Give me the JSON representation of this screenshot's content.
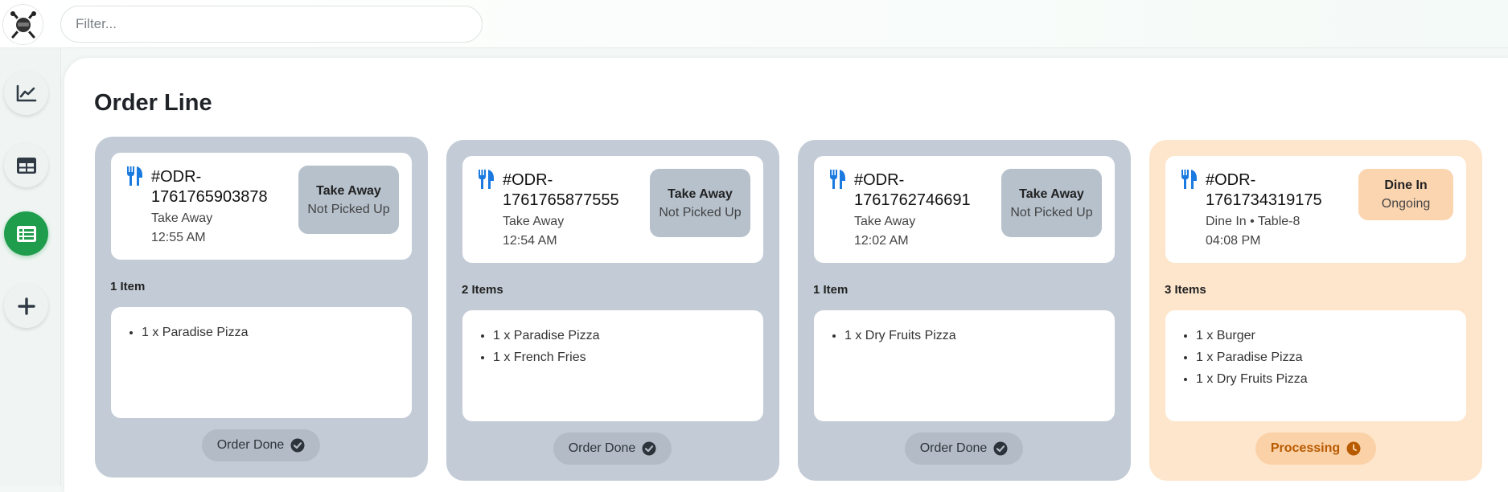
{
  "app": {
    "logo_icon": "chef-utensils-logo"
  },
  "search": {
    "placeholder": "Filter..."
  },
  "sidebar": {
    "items": [
      {
        "name": "analytics",
        "icon": "chart-line-icon",
        "active": false
      },
      {
        "name": "tables",
        "icon": "table-icon",
        "active": false
      },
      {
        "name": "orders",
        "icon": "order-list-icon",
        "active": true
      },
      {
        "name": "add",
        "icon": "plus-icon",
        "active": false
      }
    ]
  },
  "page": {
    "title": "Order Line"
  },
  "colors": {
    "accent": "#1f9d4c",
    "takeaway_card": "#c3ccd6",
    "dinein_card": "#fde6cc",
    "fork_icon": "#1a7ae0",
    "processing_text": "#b85a00"
  },
  "orders": [
    {
      "id_line1": "#ODR-",
      "id_line2": "1761765903878",
      "type": "Take Away",
      "time": "12:55 AM",
      "badge_title": "Take Away",
      "badge_status": "Not Picked Up",
      "items_count": "1 Item",
      "items": [
        "1 x Paradise Pizza"
      ],
      "action": "Order Done"
    },
    {
      "id_line1": "#ODR-",
      "id_line2": "1761765877555",
      "type": "Take Away",
      "time": "12:54 AM",
      "badge_title": "Take Away",
      "badge_status": "Not Picked Up",
      "items_count": "2 Items",
      "items": [
        "1 x Paradise Pizza",
        "1 x French Fries"
      ],
      "action": "Order Done"
    },
    {
      "id_line1": "#ODR-",
      "id_line2": "1761762746691",
      "type": "Take Away",
      "time": "12:02 AM",
      "badge_title": "Take Away",
      "badge_status": "Not Picked Up",
      "items_count": "1 Item",
      "items": [
        "1 x Dry Fruits Pizza"
      ],
      "action": "Order Done"
    },
    {
      "id_line1": "#ODR-",
      "id_line2": "1761734319175",
      "type": "Dine In • Table-8",
      "time": "04:08 PM",
      "badge_title": "Dine In",
      "badge_status": "Ongoing",
      "items_count": "3 Items",
      "items": [
        "1 x Burger",
        "1 x Paradise Pizza",
        "1 x Dry Fruits Pizza"
      ],
      "action": "Processing"
    }
  ]
}
